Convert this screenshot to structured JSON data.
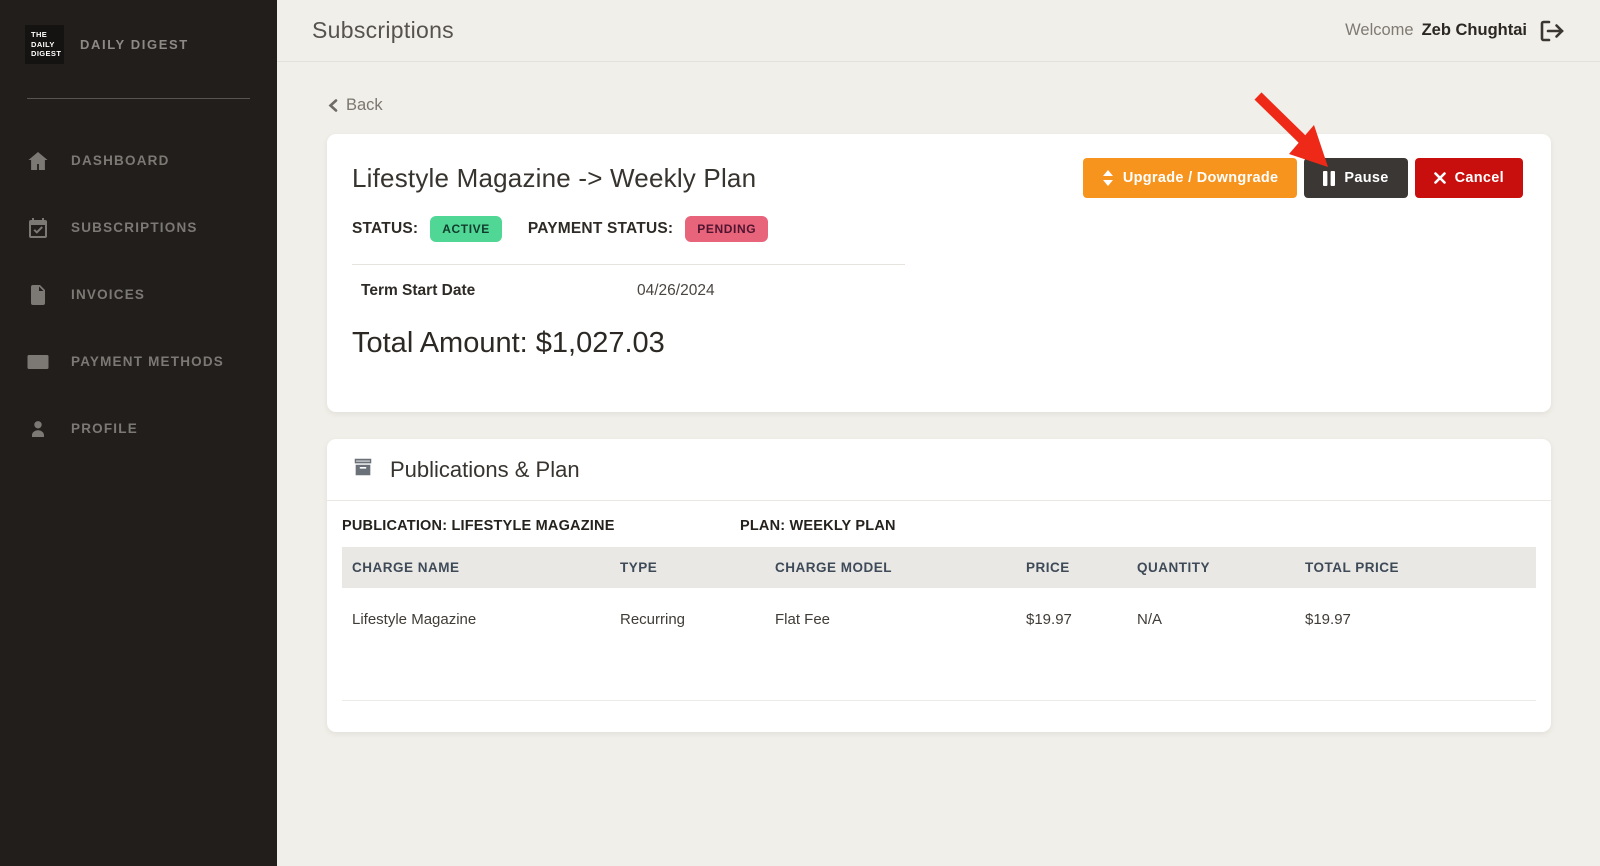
{
  "brand": {
    "logo_line1": "THE",
    "logo_line2": "DAILY",
    "logo_line3": "DIGEST",
    "name": "DAILY DIGEST"
  },
  "sidebar": {
    "items": [
      {
        "label": "DASHBOARD",
        "icon": "home-icon"
      },
      {
        "label": "SUBSCRIPTIONS",
        "icon": "calendar-check-icon"
      },
      {
        "label": "INVOICES",
        "icon": "invoice-icon"
      },
      {
        "label": "PAYMENT METHODS",
        "icon": "credit-card-icon"
      },
      {
        "label": "PROFILE",
        "icon": "person-icon"
      }
    ]
  },
  "header": {
    "title": "Subscriptions",
    "welcome_label": "Welcome",
    "user_name": "Zeb Chughtai"
  },
  "main": {
    "back_label": "Back",
    "subscription": {
      "title": "Lifestyle Magazine -> Weekly Plan",
      "status_label": "STATUS:",
      "status_value": "ACTIVE",
      "payment_status_label": "PAYMENT STATUS:",
      "payment_status_value": "PENDING",
      "term_start_label": "Term Start Date",
      "term_start_value": "04/26/2024",
      "total_amount": "Total Amount: $1,027.03",
      "buttons": {
        "upgrade": "Upgrade / Downgrade",
        "pause": "Pause",
        "cancel": "Cancel"
      }
    },
    "publications": {
      "title": "Publications & Plan",
      "publication_label": "PUBLICATION: LIFESTYLE MAGAZINE",
      "plan_label": "PLAN: WEEKLY PLAN",
      "table": {
        "headers": [
          "CHARGE NAME",
          "TYPE",
          "CHARGE MODEL",
          "PRICE",
          "QUANTITY",
          "TOTAL PRICE"
        ],
        "rows": [
          [
            "Lifestyle Magazine",
            "Recurring",
            "Flat Fee",
            "$19.97",
            "N/A",
            "$19.97"
          ]
        ]
      }
    }
  },
  "colors": {
    "sidebar_bg": "#211E1C",
    "page_bg": "#F1EFE9",
    "accent_orange": "#F7941D",
    "pause_dark": "#3B3734",
    "cancel_red": "#C90F0E",
    "arrow_red": "#EF2917",
    "active_badge_bg": "#50D695",
    "active_badge_text": "#113B2C",
    "pending_badge_bg": "#E8647B",
    "pending_badge_text": "#4F1430"
  }
}
